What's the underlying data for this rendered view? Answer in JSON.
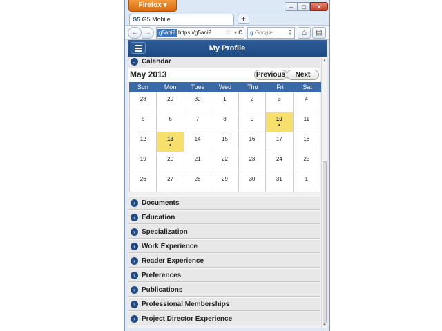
{
  "browser": {
    "menu_button": "Firefox ▾",
    "window_controls": {
      "minimize": "–",
      "maximize": "□",
      "close": "✕"
    },
    "tab": {
      "favicon_text": "G5",
      "title": "G5 Mobile"
    },
    "new_tab": "+",
    "nav": {
      "back": "←",
      "forward": "→",
      "identity": "g5ani2",
      "url": "https://g5ani2",
      "bookmark_star": "☆",
      "dropdown": "▾",
      "reload": "C",
      "search_engine": "g",
      "search_placeholder": "Google",
      "search_btn": "⚲",
      "home": "⌂",
      "extra": "▤"
    }
  },
  "app": {
    "title": "My Profile",
    "calendar_section": "Calendar",
    "calendar": {
      "month": "May 2013",
      "prev_label": "Previous",
      "next_label": "Next",
      "weekdays": [
        "Sun",
        "Mon",
        "Tues",
        "Wed",
        "Thu",
        "Fri",
        "Sat"
      ],
      "weeks": [
        [
          "28",
          "29",
          "30",
          "1",
          "2",
          "3",
          "4"
        ],
        [
          "5",
          "6",
          "7",
          "8",
          "9",
          "10",
          "11"
        ],
        [
          "12",
          "13",
          "14",
          "15",
          "16",
          "17",
          "18"
        ],
        [
          "19",
          "20",
          "21",
          "22",
          "23",
          "24",
          "25"
        ],
        [
          "26",
          "27",
          "28",
          "29",
          "30",
          "31",
          "1"
        ]
      ],
      "event_marker": "•"
    },
    "sections": [
      "Documents",
      "Education",
      "Specialization",
      "Work Experience",
      "Reader Experience",
      "Preferences",
      "Publications",
      "Professional Memberships",
      "Project Director Experience"
    ],
    "highlight_color": "#f7df6b",
    "accent_color": "#1f4a84"
  }
}
